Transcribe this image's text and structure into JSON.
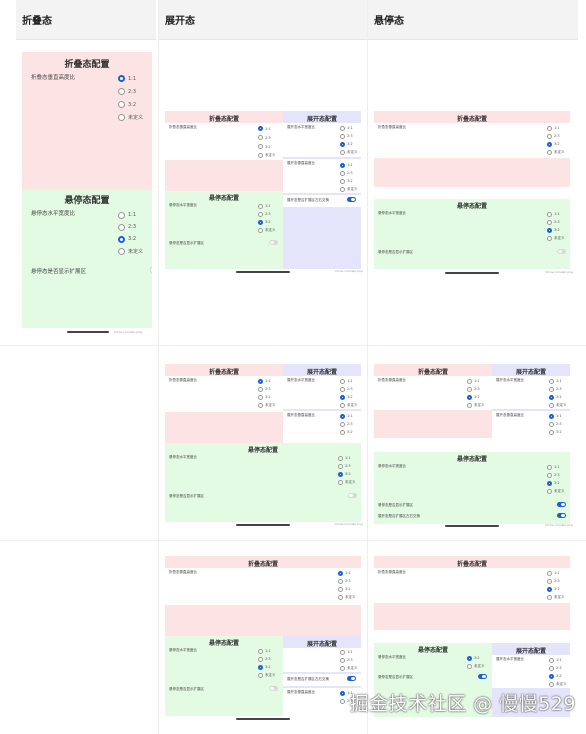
{
  "headers": {
    "col1": "折叠态",
    "col2": "展开态",
    "col3": "悬停态"
  },
  "titles": {
    "fold": "折叠态配置",
    "expand": "展开态配置",
    "hover": "悬停态配置"
  },
  "labels": {
    "fold_ratio": "折叠态垂直高度比",
    "hover_ratio": "悬停态水平宽度比",
    "hover_show_expand": "悬停态是否显示扩展区",
    "expand_h_ratio": "展开态水平宽度比",
    "expand_v_ratio": "展开态垂直高度比",
    "expand_toggle": "展开态是否扩展区左右交换"
  },
  "options": [
    "1:1",
    "2:3",
    "3:2",
    "未定义"
  ],
  "footnote": "hmos.com/api.png",
  "watermark": "掘金技术社区 @ 慢慢529",
  "colors": {
    "fold": "#fde4e4",
    "hover": "#e3fae3",
    "expand": "#e4e4fb",
    "accent": "#1a5fd6"
  }
}
